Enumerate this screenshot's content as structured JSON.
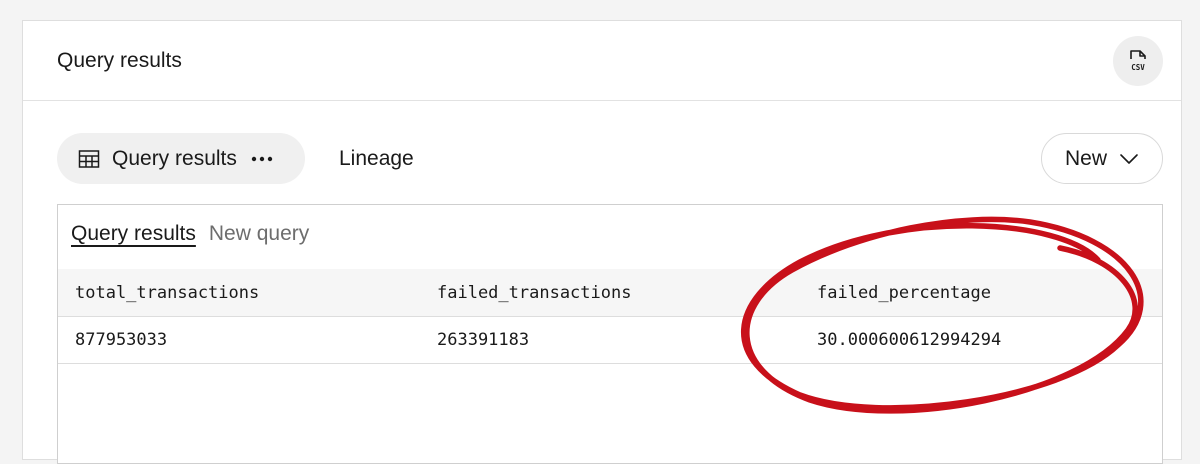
{
  "panel": {
    "title": "Query results",
    "csv_icon": "csv-file-download-icon"
  },
  "tabs": {
    "active": {
      "icon": "table-icon",
      "label": "Query results",
      "more_icon": "more-horizontal-icon"
    },
    "lineage_label": "Lineage",
    "new_button": {
      "label": "New",
      "icon": "chevron-down-icon"
    }
  },
  "results": {
    "sub_tabs": [
      "Query results",
      "New query"
    ],
    "columns": [
      "total_transactions",
      "failed_transactions",
      "failed_percentage"
    ],
    "rows": [
      [
        "877953033",
        "263391183",
        "30.000600612994294"
      ]
    ]
  },
  "annotation": {
    "type": "hand-drawn circle",
    "color": "#c8101a"
  },
  "colors": {
    "background": "#f4f4f4",
    "panel": "#ffffff",
    "header_row": "#f6f6f6",
    "muted_text": "#6d6d6d"
  }
}
